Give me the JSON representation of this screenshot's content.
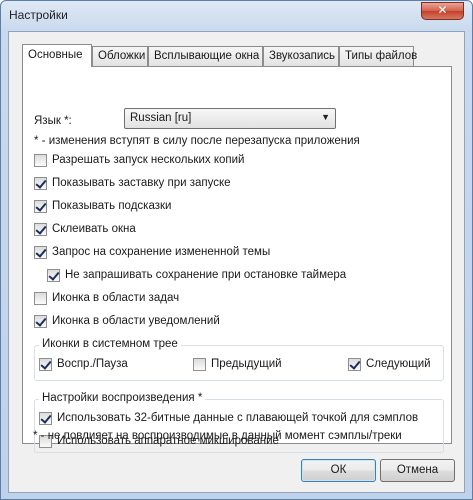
{
  "window": {
    "title": "Настройки",
    "close_glyph": "✕"
  },
  "tabs": [
    "Основные",
    "Обложки",
    "Всплывающие окна",
    "Звукозапись",
    "Типы файлов"
  ],
  "general": {
    "language_label": "Язык *:",
    "language_value": "Russian [ru]",
    "restart_note": "* - изменения вступят в силу после перезапуска приложения",
    "options": [
      {
        "label": "Разрешать запуск нескольких копий",
        "checked": false
      },
      {
        "label": "Показывать заставку при запуске",
        "checked": true
      },
      {
        "label": "Показывать подсказки",
        "checked": true
      },
      {
        "label": "Склеивать окна",
        "checked": true
      },
      {
        "label": "Запрос на сохранение измененной темы",
        "checked": true
      },
      {
        "label": "Не запрашивать сохранение при остановке таймера",
        "checked": true
      },
      {
        "label": "Иконка в области задач",
        "checked": false
      },
      {
        "label": "Иконка в области уведомлений",
        "checked": true
      }
    ],
    "tray_group": {
      "title": "Иконки в системном трее",
      "items": [
        {
          "label": "Воспр./Пауза",
          "checked": true
        },
        {
          "label": "Предыдущий",
          "checked": false
        },
        {
          "label": "Следующий",
          "checked": true
        }
      ]
    },
    "playback_group": {
      "title": "Настройки воспроизведения *",
      "items": [
        {
          "label": "Использовать 32-битные данные с плавающей точкой для сэмплов",
          "checked": true
        },
        {
          "label": "Использовать аппаратное микширование",
          "checked": false
        }
      ]
    },
    "playback_note": "* - не повлияет на воспроизводимые в данный момент сэмплы/треки"
  },
  "buttons": {
    "ok": "ОК",
    "cancel": "Отмена"
  }
}
